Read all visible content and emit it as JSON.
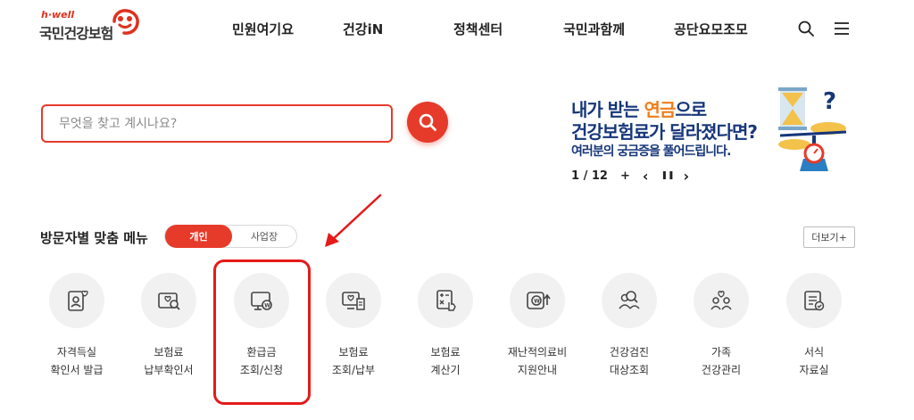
{
  "header": {
    "logo_small": "h·well",
    "logo_name": "국민건강보험",
    "nav": [
      "민원여기요",
      "건강iN",
      "정책센터",
      "국민과함께",
      "공단요모조모"
    ],
    "icons": [
      "search-icon",
      "menu-icon"
    ]
  },
  "search": {
    "placeholder": "무엇을 찾고 계시나요?",
    "icon": "search-icon",
    "accent": "#e63a2a"
  },
  "banner": {
    "line1_pre": "내가 받는 ",
    "line1_highlight": "연금",
    "line1_post": "으로",
    "line2": "건강보험료가 달라졌다면?",
    "line3": "여러분의 궁금증을 풀어드립니다.",
    "pager": "1 / 12",
    "plus": "+",
    "prev": "‹",
    "pause": "❚❚",
    "next": "›",
    "title_color": "#16367a",
    "highlight_color": "#ef7d1a"
  },
  "section": {
    "title": "방문자별 맞춤 메뉴",
    "toggle_on": "개인",
    "toggle_off": "사업장",
    "more": "더보기+"
  },
  "menu": [
    {
      "line1": "자격득실",
      "line2": "확인서 발급",
      "icon": "id-card-heart-icon"
    },
    {
      "line1": "보험료",
      "line2": "납부확인서",
      "icon": "document-search-icon"
    },
    {
      "line1": "환급금",
      "line2": "조회/신청",
      "icon": "monitor-won-icon"
    },
    {
      "line1": "보험료",
      "line2": "조회/납부",
      "icon": "monitor-receipt-icon"
    },
    {
      "line1": "보험료",
      "line2": "계산기",
      "icon": "calculator-icon"
    },
    {
      "line1": "재난적의료비",
      "line2": "지원안내",
      "icon": "won-support-icon"
    },
    {
      "line1": "건강검진",
      "line2": "대상조회",
      "icon": "people-search-icon"
    },
    {
      "line1": "가족",
      "line2": "건강관리",
      "icon": "family-heart-icon"
    },
    {
      "line1": "서식",
      "line2": "자료실",
      "icon": "form-document-icon"
    }
  ]
}
